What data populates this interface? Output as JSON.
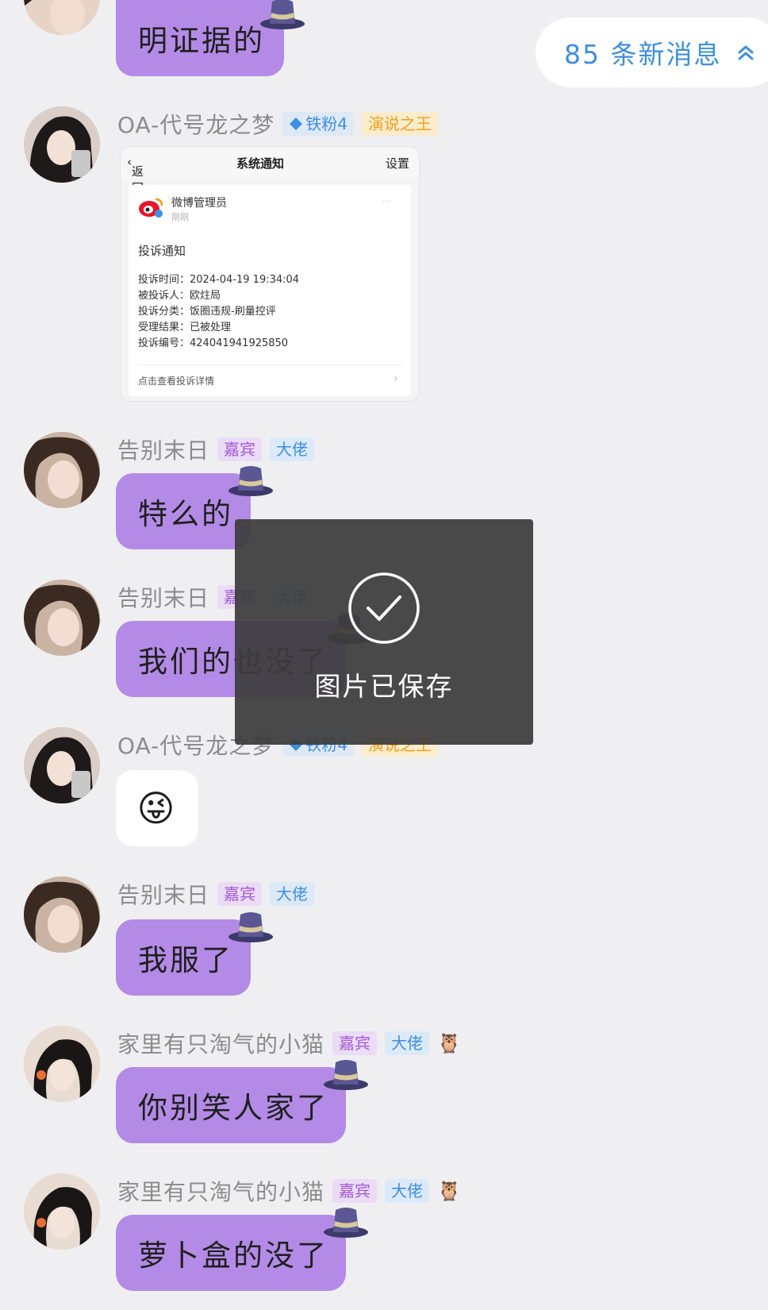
{
  "new_messages": {
    "label": "85 条新消息"
  },
  "badges": {
    "guest": "嘉宾",
    "boss": "大佬",
    "fan": "铁粉4",
    "speech": "演说之王"
  },
  "messages": [
    {
      "id": 0,
      "sender": "",
      "text": "明证据的"
    },
    {
      "id": 1,
      "sender": "OA-代号龙之梦",
      "type": "image"
    },
    {
      "id": 2,
      "sender": "告别末日",
      "text": "特么的"
    },
    {
      "id": 3,
      "sender": "告别末日",
      "text": "我们的也没了"
    },
    {
      "id": 4,
      "sender": "OA-代号龙之梦",
      "type": "emoji",
      "emoji": "😜"
    },
    {
      "id": 5,
      "sender": "告别末日",
      "text": "我服了"
    },
    {
      "id": 6,
      "sender": "家里有只淘气的小猫",
      "text": "你别笑人家了"
    },
    {
      "id": 7,
      "sender": "家里有只淘气的小猫",
      "text": "萝卜盒的没了"
    }
  ],
  "shared_image": {
    "back": "返回",
    "title": "系统通知",
    "settings": "设置",
    "account": "微博管理员",
    "time_ago": "刚刚",
    "heading": "投诉通知",
    "lines": [
      "投诉时间：2024-04-19 19:34:04",
      "被投诉人：欧炷局",
      "投诉分类：饭圈违规-刷量控评",
      "受理结果：已被处理",
      "投诉编号：424041941925850"
    ],
    "footer": "点击查看投诉详情"
  },
  "toast": {
    "text": "图片已保存"
  },
  "colors": {
    "bubble": "#b38be6",
    "background": "#efeff1",
    "accent": "#3f8fdc"
  }
}
